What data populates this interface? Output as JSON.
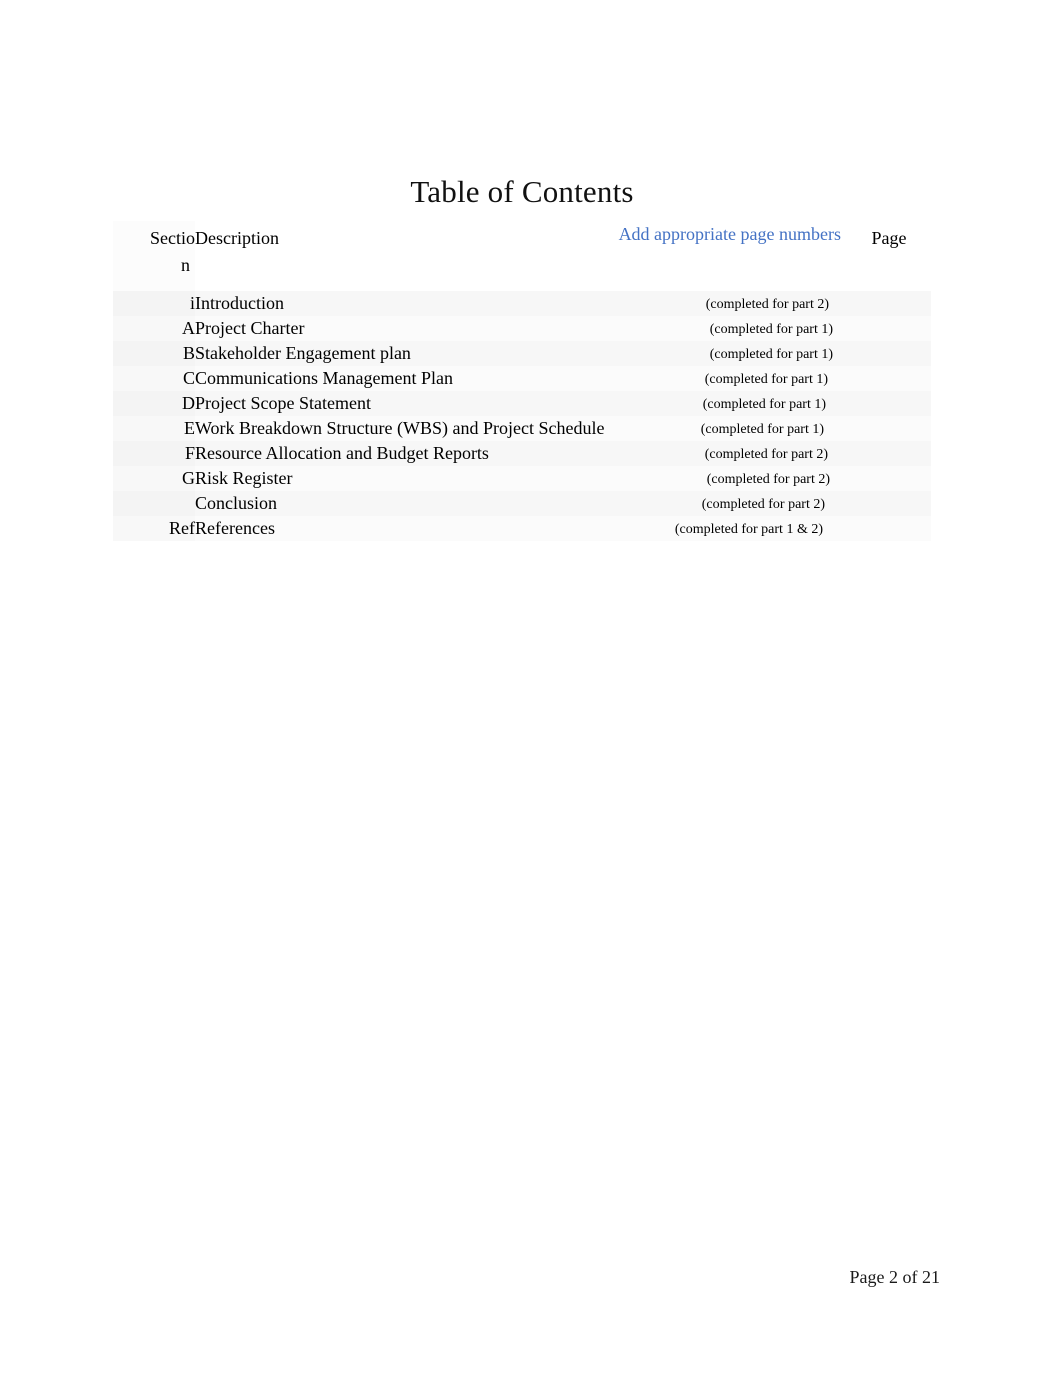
{
  "document": {
    "title": "Table of Contents"
  },
  "toc": {
    "title": "Table of Contents",
    "header": {
      "section_label_line1": "Sectio",
      "section_label_line2": "n",
      "description_label": "Description",
      "instruction": "Add appropriate page numbers",
      "instruction_color": "#4472C4",
      "page_label": "Page"
    },
    "columns": [
      "Section",
      "Description",
      "Page"
    ],
    "rows": [
      {
        "section": "i",
        "description": "Introduction",
        "note": "(completed for part 2)",
        "page": ""
      },
      {
        "section": "A",
        "description": "Project Charter",
        "note": "(completed for part 1)",
        "page": ""
      },
      {
        "section": "B",
        "description": "Stakeholder Engagement plan",
        "note": "(completed for part 1)",
        "page": ""
      },
      {
        "section": "C",
        "description": "Communications Management Plan",
        "note": "(completed for part 1)",
        "page": ""
      },
      {
        "section": "D",
        "description": "Project Scope Statement",
        "note": "(completed for part 1)",
        "page": ""
      },
      {
        "section": "E",
        "description": "Work Breakdown Structure (WBS) and Project Schedule",
        "note": "(completed for part 1)",
        "page": ""
      },
      {
        "section": "F",
        "description": "Resource Allocation and Budget Reports",
        "note": "(completed for part 2)",
        "page": ""
      },
      {
        "section": "G",
        "description": "Risk Register",
        "note": "(completed for part 2)",
        "page": ""
      },
      {
        "section": "",
        "description": "Conclusion",
        "note": "(completed for part 2)",
        "page": ""
      },
      {
        "section": "Ref",
        "description": "References",
        "note": "(completed for part 1 & 2)",
        "page": ""
      }
    ]
  },
  "footer": {
    "page_text": "Page 2 of 21"
  }
}
